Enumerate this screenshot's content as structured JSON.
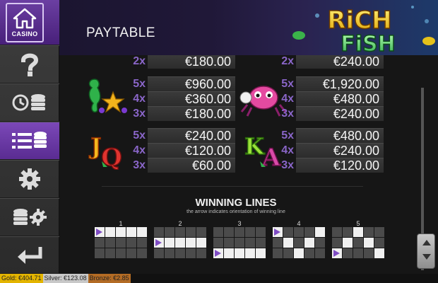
{
  "sidebar": {
    "casino_label": "CASINO",
    "buttons": [
      {
        "name": "help",
        "icon": "question-icon"
      },
      {
        "name": "history",
        "icon": "history-coins-icon"
      },
      {
        "name": "paytable",
        "icon": "paytable-list-icon",
        "active": true
      },
      {
        "name": "settings",
        "icon": "gear-icon"
      },
      {
        "name": "coin-settings",
        "icon": "coins-gear-icon"
      },
      {
        "name": "back",
        "icon": "back-arrow-icon"
      }
    ]
  },
  "header": {
    "title": "PAYTABLE",
    "logo_line1": "RiCH",
    "logo_line2": "FiSH"
  },
  "paytable": {
    "top_partial": {
      "left": {
        "mult": "2x",
        "amount": "€180.00"
      },
      "right": {
        "mult": "2x",
        "amount": "€240.00"
      }
    },
    "blocks": [
      {
        "symbol": "seahorse-starfish",
        "rows": [
          {
            "mult": "5x",
            "amount": "€960.00"
          },
          {
            "mult": "4x",
            "amount": "€360.00"
          },
          {
            "mult": "3x",
            "amount": "€180.00"
          }
        ]
      },
      {
        "symbol": "crab",
        "rows": [
          {
            "mult": "5x",
            "amount": "€1,920.00"
          },
          {
            "mult": "4x",
            "amount": "€480.00"
          },
          {
            "mult": "3x",
            "amount": "€240.00"
          }
        ]
      },
      {
        "symbol": "J-Q",
        "rows": [
          {
            "mult": "5x",
            "amount": "€240.00"
          },
          {
            "mult": "4x",
            "amount": "€120.00"
          },
          {
            "mult": "3x",
            "amount": "€60.00"
          }
        ]
      },
      {
        "symbol": "K-A",
        "rows": [
          {
            "mult": "5x",
            "amount": "€480.00"
          },
          {
            "mult": "4x",
            "amount": "€240.00"
          },
          {
            "mult": "3x",
            "amount": "€120.00"
          }
        ]
      }
    ]
  },
  "winning_lines": {
    "title": "WINNING LINES",
    "subtitle": "the arrow indicates orientation of winning line",
    "lines": [
      {
        "number": "1",
        "row": 0
      },
      {
        "number": "2",
        "row": 1
      },
      {
        "number": "3",
        "row": 2
      },
      {
        "number": "4",
        "row": "v"
      },
      {
        "number": "5",
        "row": "^"
      }
    ]
  },
  "footer": {
    "gold": "Gold: €404.71",
    "silver": "Silver: €123.08",
    "bronze": "Bronze: €2.85"
  },
  "colors": {
    "accent": "#6b3fa2",
    "multiplier": "#8a66c9",
    "gold": "#e3b400",
    "silver": "#c8c8c8",
    "bronze": "#b36b24"
  }
}
